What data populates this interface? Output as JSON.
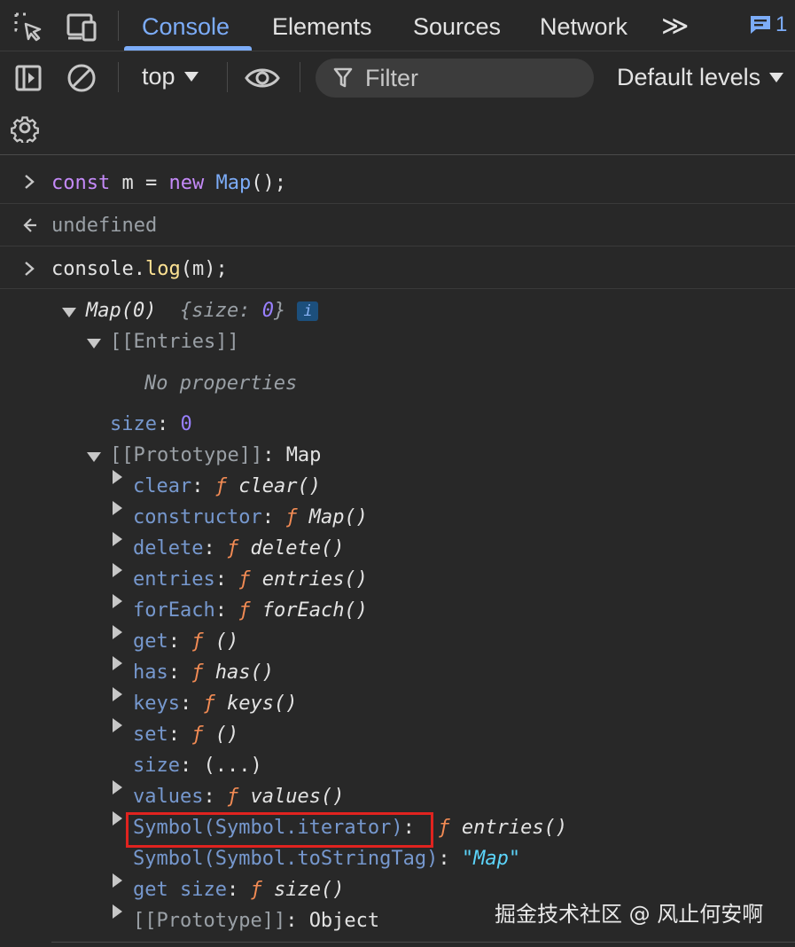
{
  "tabs": {
    "console": "Console",
    "elements": "Elements",
    "sources": "Sources",
    "network": "Network",
    "more": "≫",
    "message_count": "1"
  },
  "toolbar": {
    "context": "top",
    "filter_placeholder": "Filter",
    "levels": "Default levels"
  },
  "console": {
    "input1": {
      "kw": "const",
      "rest1": " m = ",
      "kw2": "new",
      "cls": " Map",
      "rest2": "();"
    },
    "output1": "undefined",
    "input2": {
      "obj": "console.",
      "fn": "log",
      "rest": "(m);"
    },
    "map_header": {
      "name": "Map(0)",
      "summary": "{size: ",
      "size": "0",
      "close": "}",
      "badge": "i"
    },
    "entries_label": "[[Entries]]",
    "no_properties": "No properties",
    "size_row": {
      "key": "size",
      "colon": ": ",
      "value": "0"
    },
    "proto_row": {
      "key": "[[Prototype]]",
      "colon": ": ",
      "value": "Map"
    },
    "proto_items": [
      {
        "key": "clear",
        "fn": "clear()"
      },
      {
        "key": "constructor",
        "fn": "Map()"
      },
      {
        "key": "delete",
        "fn": "delete()"
      },
      {
        "key": "entries",
        "fn": "entries()"
      },
      {
        "key": "forEach",
        "fn": "forEach()"
      },
      {
        "key": "get",
        "fn": "()"
      },
      {
        "key": "has",
        "fn": "has()"
      },
      {
        "key": "keys",
        "fn": "keys()"
      },
      {
        "key": "set",
        "fn": "()"
      }
    ],
    "size_getter": {
      "key": "size",
      "value": ": (...)"
    },
    "values_row": {
      "key": "values",
      "fn": "values()"
    },
    "iterator_row": {
      "key": "Symbol(Symbol.iterator)",
      "fn": "entries()"
    },
    "tostringtag_row": {
      "key": "Symbol(Symbol.toStringTag)",
      "value": "\"Map\""
    },
    "get_size_row": {
      "key": "get size",
      "fn": "size()"
    },
    "object_proto_row": {
      "key": "[[Prototype]]",
      "value": "Object"
    },
    "f_symbol": "ƒ",
    "colon": ": "
  },
  "watermark": "掘金技术社区 @ 风止何安啊",
  "colors": {
    "accent": "#7cacf8",
    "highlight_box": "#e0231f",
    "background": "#282828"
  }
}
